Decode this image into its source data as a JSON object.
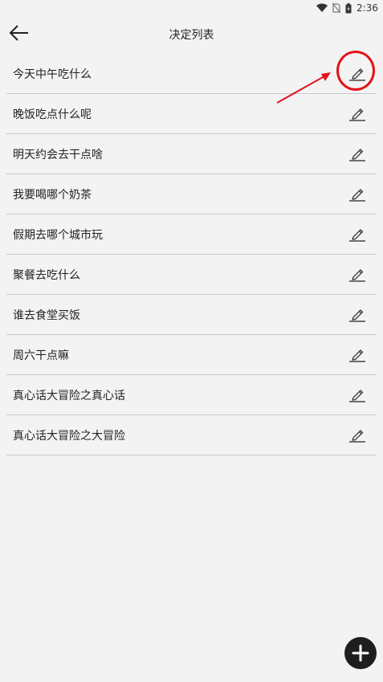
{
  "status_bar": {
    "time": "2:36",
    "icons": [
      "wifi-icon",
      "no-sim-icon",
      "battery-icon"
    ]
  },
  "app_bar": {
    "back_icon": "arrow-left-icon",
    "title": "决定列表"
  },
  "decisions": [
    {
      "label": "今天中午吃什么"
    },
    {
      "label": "晚饭吃点什么呢"
    },
    {
      "label": "明天约会去干点啥"
    },
    {
      "label": "我要喝哪个奶茶"
    },
    {
      "label": "假期去哪个城市玩"
    },
    {
      "label": "聚餐去吃什么"
    },
    {
      "label": "谁去食堂买饭"
    },
    {
      "label": "周六干点嘛"
    },
    {
      "label": "真心话大冒险之真心话"
    },
    {
      "label": "真心话大冒险之大冒险"
    }
  ],
  "row_action_icon": "pencil-edit-icon",
  "fab_icon": "plus-icon",
  "colors": {
    "background": "#f3f3f3",
    "divider": "#c9c9c9",
    "annotation": "#e3131b",
    "fab": "#1e1e1e"
  }
}
